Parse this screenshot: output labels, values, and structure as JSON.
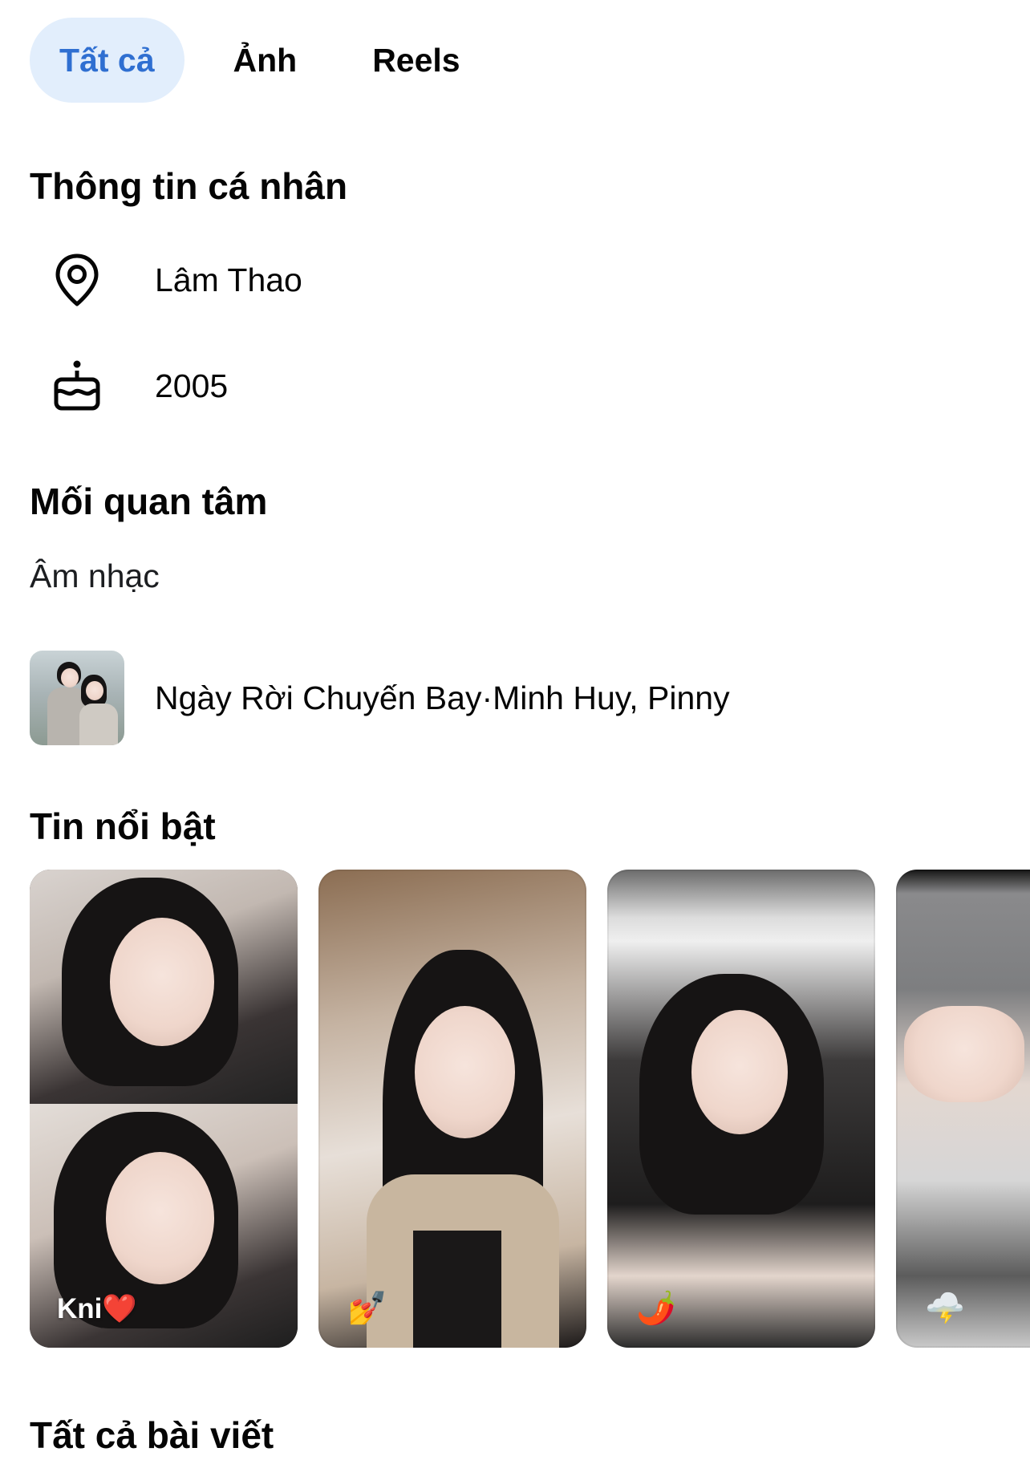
{
  "tabs": [
    {
      "label": "Tất cả",
      "active": true
    },
    {
      "label": "Ảnh",
      "active": false
    },
    {
      "label": "Reels",
      "active": false
    }
  ],
  "about": {
    "title": "Thông tin cá nhân",
    "items": [
      {
        "icon": "location-pin-icon",
        "text": "Lâm Thao"
      },
      {
        "icon": "birthday-cake-icon",
        "text": "2005"
      }
    ]
  },
  "interests": {
    "title": "Mối quan tâm",
    "category": "Âm nhạc",
    "song": "Ngày Rời Chuyến Bay·Minh Huy, Pinny"
  },
  "highlights": {
    "title": "Tin nổi bật",
    "items": [
      {
        "label": "Kni",
        "emoji": "❤️"
      },
      {
        "label": "",
        "emoji": "💅"
      },
      {
        "label": "",
        "emoji": "🌶️"
      },
      {
        "label": "",
        "emoji": "🌩️"
      }
    ]
  },
  "posts": {
    "title": "Tất cả bài viết"
  },
  "colors": {
    "accent": "#2f6fd1",
    "active_tab_bg": "#e2eefc",
    "text": "#050505"
  }
}
